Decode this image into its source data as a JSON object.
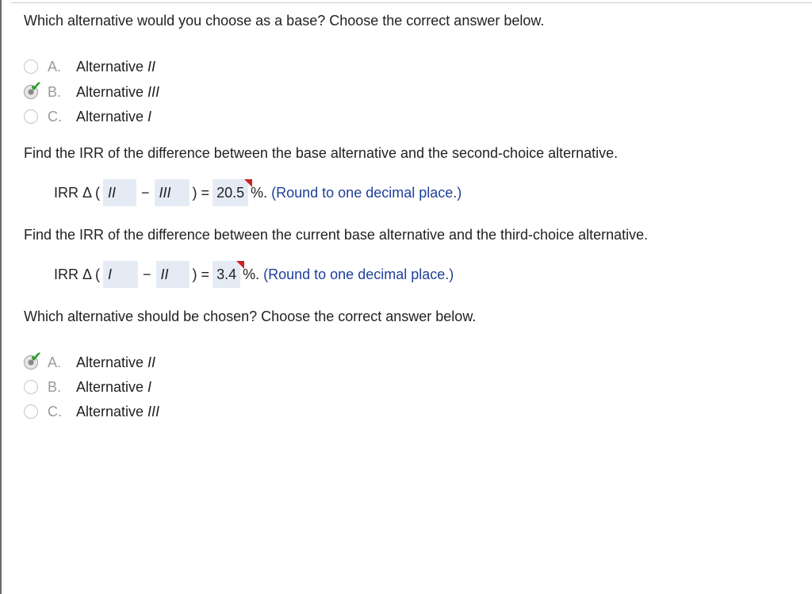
{
  "question1": {
    "prompt": "Which alternative would you choose as a base? Choose the correct answer below.",
    "options": [
      {
        "letter": "A.",
        "text_prefix": "Alternative ",
        "text_roman": "II",
        "selected": false
      },
      {
        "letter": "B.",
        "text_prefix": "Alternative ",
        "text_roman": "III",
        "selected": true
      },
      {
        "letter": "C.",
        "text_prefix": "Alternative ",
        "text_roman": "I",
        "selected": false
      }
    ]
  },
  "question2": {
    "prompt": "Find the IRR of the difference between the base alternative and the second-choice alternative.",
    "label": "IRR Δ (",
    "first": "II",
    "minus": "−",
    "second": "III",
    "close": ") =",
    "value": "20.5",
    "suffix": "%.",
    "hint": "(Round to one decimal place.)"
  },
  "question3": {
    "prompt": "Find the IRR of the difference between the current base alternative and the third-choice alternative.",
    "label": "IRR Δ (",
    "first": "I",
    "minus": "−",
    "second": "II",
    "close": ") =",
    "value": "3.4",
    "suffix": "%.",
    "hint": "(Round to one decimal place.)"
  },
  "question4": {
    "prompt": "Which alternative should be chosen? Choose the correct answer below.",
    "options": [
      {
        "letter": "A.",
        "text_prefix": "Alternative ",
        "text_roman": "II",
        "selected": true
      },
      {
        "letter": "B.",
        "text_prefix": "Alternative ",
        "text_roman": "I",
        "selected": false
      },
      {
        "letter": "C.",
        "text_prefix": "Alternative ",
        "text_roman": "III",
        "selected": false
      }
    ]
  },
  "colors": {
    "check": "#2e9e2e",
    "hint": "#1f3f99",
    "answer_box": "#e4ebf5",
    "flag": "#cc2222"
  },
  "icons": {
    "correct": "checkmark-icon",
    "flag": "feedback-flag-icon"
  }
}
